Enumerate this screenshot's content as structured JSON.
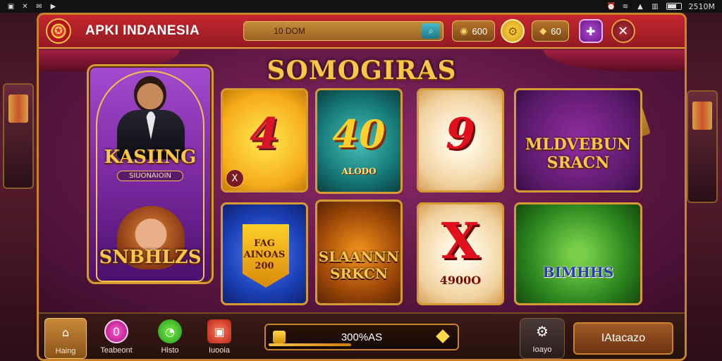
{
  "statusbar": {
    "time": "2510M"
  },
  "header": {
    "app_title": "APKI INDANESIA",
    "search_value": "10 DOM",
    "coins_label": "600",
    "gems_label": "60"
  },
  "content": {
    "section_title": "SOMOGIRAS",
    "feature": {
      "title": "KASIING",
      "subtitle": "SIUONAIOIN",
      "bottom_title": "SNBHLZS"
    },
    "tiles": [
      {
        "big": "4",
        "corner": "X"
      },
      {
        "big": "40",
        "caption": "ALODO"
      },
      {
        "big": "9"
      },
      {
        "caption": "MLDVEBUN SRACN"
      },
      {
        "caption": "FAG AINOAS 200"
      },
      {
        "caption": "SLAANNN SRKCN"
      },
      {
        "caption": "4900O"
      },
      {
        "caption": "BIMHHS"
      }
    ]
  },
  "bottom": {
    "nav": [
      {
        "label": "Haing"
      },
      {
        "label": "Teabeont"
      },
      {
        "label": "Histo"
      },
      {
        "label": "Iuooia"
      }
    ],
    "progress_text": "300%AS",
    "progress_fraction": 0.44,
    "settings_label": "Ioayo",
    "cta_label": "IAtacazo"
  }
}
